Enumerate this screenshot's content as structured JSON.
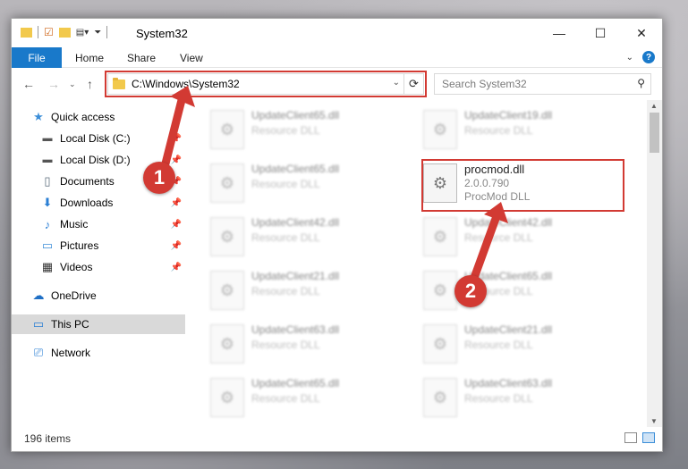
{
  "window": {
    "title": "System32",
    "controls": {
      "minimize": "—",
      "maximize": "☐",
      "close": "✕"
    }
  },
  "ribbon": {
    "tabs": [
      "File",
      "Home",
      "Share",
      "View"
    ],
    "expand_icon": "chevron-down-icon",
    "help_icon": "?"
  },
  "address": {
    "path": "C:\\Windows\\System32",
    "refresh_glyph": "⟳"
  },
  "search": {
    "placeholder": "Search System32"
  },
  "sidebar": {
    "items": [
      {
        "label": "Quick access",
        "icon": "star-icon",
        "pinned": false
      },
      {
        "label": "Local Disk (C:)",
        "icon": "drive-icon",
        "pinned": true
      },
      {
        "label": "Local Disk (D:)",
        "icon": "drive-icon",
        "pinned": true
      },
      {
        "label": "Documents",
        "icon": "documents-icon",
        "pinned": true
      },
      {
        "label": "Downloads",
        "icon": "download-icon",
        "pinned": true
      },
      {
        "label": "Music",
        "icon": "music-icon",
        "pinned": true
      },
      {
        "label": "Pictures",
        "icon": "pictures-icon",
        "pinned": true
      },
      {
        "label": "Videos",
        "icon": "videos-icon",
        "pinned": true
      },
      {
        "label": "OneDrive",
        "icon": "cloud-icon",
        "pinned": false
      },
      {
        "label": "This PC",
        "icon": "computer-icon",
        "pinned": false,
        "selected": true
      },
      {
        "label": "Network",
        "icon": "network-icon",
        "pinned": false
      }
    ]
  },
  "files": {
    "left": [
      {
        "name": "UpdateClient65.dll",
        "desc": "Resource DLL"
      },
      {
        "name": "UpdateClient65.dll",
        "desc": "Resource DLL"
      },
      {
        "name": "UpdateClient42.dll",
        "desc": "Resource DLL"
      },
      {
        "name": "UpdateClient21.dll",
        "desc": "Resource DLL"
      },
      {
        "name": "UpdateClient63.dll",
        "desc": "Resource DLL"
      },
      {
        "name": "UpdateClient65.dll",
        "desc": "Resource DLL"
      }
    ],
    "right": [
      {
        "name": "UpdateClient19.dll",
        "desc": "Resource DLL"
      },
      {
        "name": "procmod.dll",
        "version": "2.0.0.790",
        "desc": "ProcMod DLL",
        "highlighted": true
      },
      {
        "name": "UpdateClient42.dll",
        "desc": "Resource DLL"
      },
      {
        "name": "UpdateClient65.dll",
        "desc": "Resource DLL"
      },
      {
        "name": "UpdateClient21.dll",
        "desc": "Resource DLL"
      },
      {
        "name": "UpdateClient63.dll",
        "desc": "Resource DLL"
      }
    ]
  },
  "status": {
    "item_count": "196 items"
  },
  "callouts": {
    "step1": "1",
    "step2": "2"
  },
  "colors": {
    "accent": "#1979ca",
    "annotation_red": "#d23a33"
  }
}
